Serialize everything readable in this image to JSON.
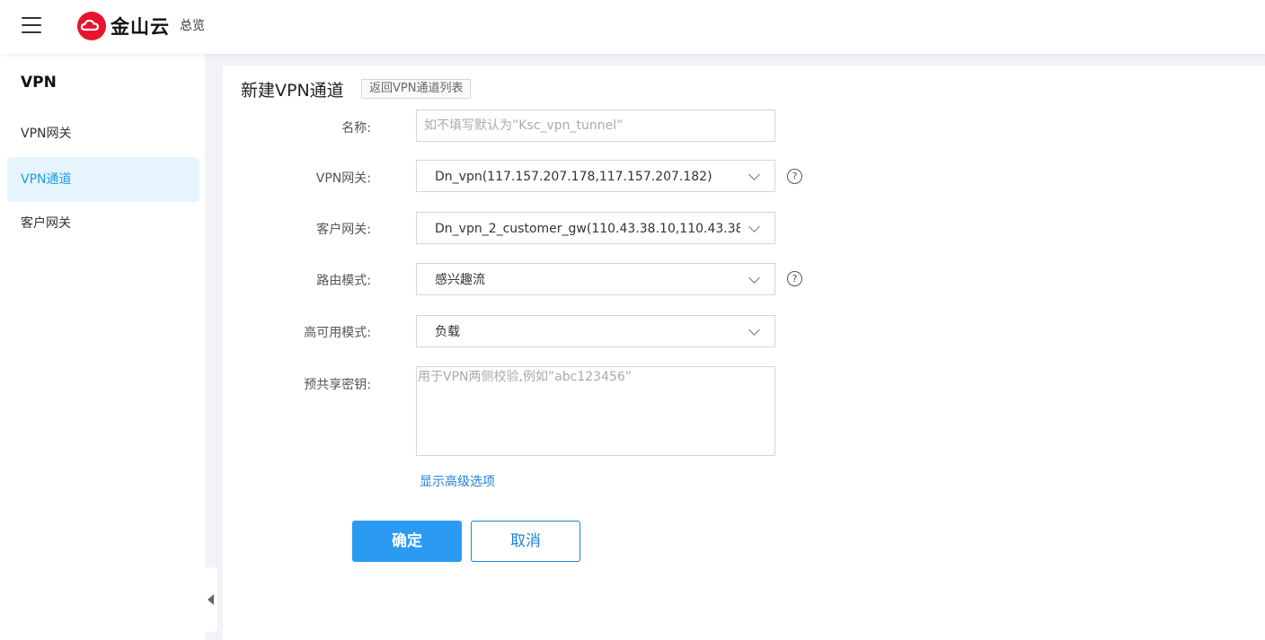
{
  "header": {
    "brand": "金山云",
    "nav_overview": "总览",
    "brand_color": "#e8132d"
  },
  "sidebar": {
    "title": "VPN",
    "items": [
      {
        "label": "VPN网关",
        "active": false
      },
      {
        "label": "VPN通道",
        "active": true
      },
      {
        "label": "客户网关",
        "active": false
      }
    ]
  },
  "page": {
    "title": "新建VPN通道",
    "back_link": "返回VPN通道列表"
  },
  "form": {
    "name": {
      "label": "名称:",
      "value": "",
      "placeholder": "如不填写默认为”Ksc_vpn_tunnel”"
    },
    "vpn_gateway": {
      "label": "VPN网关:",
      "value": "Dn_vpn(117.157.207.178,117.157.207.182)",
      "help_icon": "question-circle-icon"
    },
    "customer_gateway": {
      "label": "客户网关:",
      "value": "Dn_vpn_2_customer_gw(110.43.38.10,110.43.38"
    },
    "route_mode": {
      "label": "路由模式:",
      "value": "感兴趣流",
      "help_icon": "question-circle-icon"
    },
    "ha_mode": {
      "label": "高可用模式:",
      "value": "负载"
    },
    "psk": {
      "label": "预共享密钥:",
      "value": "",
      "placeholder": "用于VPN两侧校验,例如”abc123456”"
    },
    "advanced_link": "显示高级选项",
    "help_glyph": "?"
  },
  "actions": {
    "confirm": "确定",
    "cancel": "取消",
    "primary_color": "#2b9bf2"
  }
}
